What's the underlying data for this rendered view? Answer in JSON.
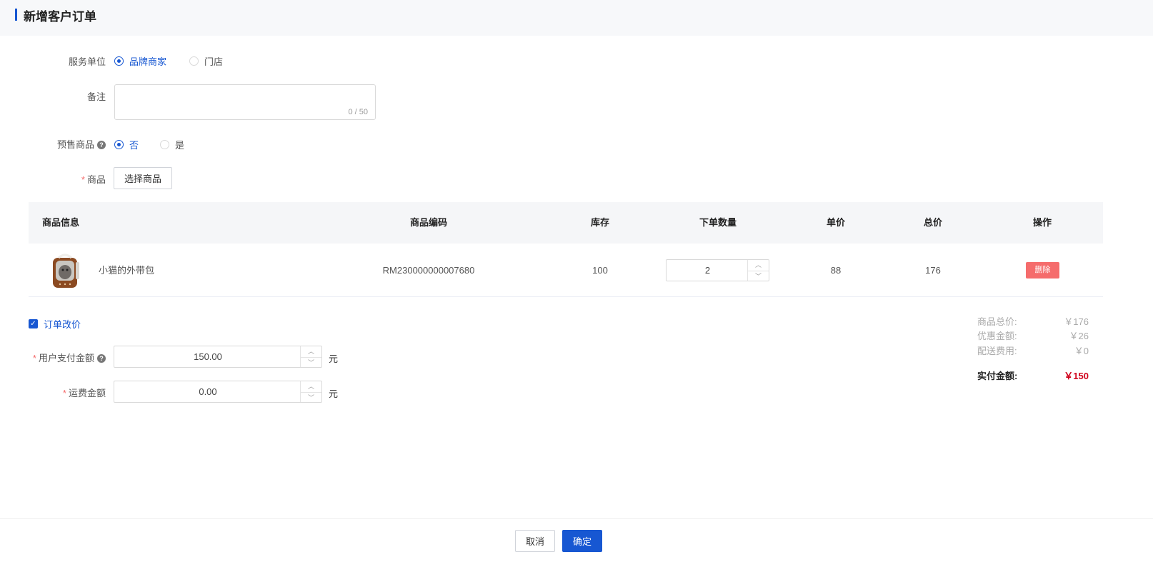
{
  "header": {
    "title": "新增客户订单"
  },
  "form": {
    "service_unit": {
      "label": "服务单位",
      "options": [
        "品牌商家",
        "门店"
      ],
      "selected": "品牌商家"
    },
    "remark": {
      "label": "备注",
      "value": "",
      "counter": "0 / 50"
    },
    "presale": {
      "label": "预售商品",
      "help": "?",
      "options": [
        "否",
        "是"
      ],
      "selected": "否"
    },
    "goods": {
      "required": "*",
      "label": "商品",
      "select_button": "选择商品"
    }
  },
  "table": {
    "columns": [
      "商品信息",
      "商品编码",
      "库存",
      "下单数量",
      "单价",
      "总价",
      "操作"
    ],
    "rows": [
      {
        "name": "小猫的外带包",
        "code": "RM230000000007680",
        "stock": "100",
        "quantity": "2",
        "unit_price": "88",
        "total": "176",
        "action": "删除"
      }
    ]
  },
  "price_change": {
    "checkbox_label": "订单改价",
    "checked": true,
    "user_payment": {
      "required": "*",
      "label": "用户支付金额",
      "help": "?",
      "value": "150.00",
      "unit": "元"
    },
    "freight": {
      "required": "*",
      "label": "运费金额",
      "value": "0.00",
      "unit": "元"
    }
  },
  "summary": {
    "goods_total": {
      "label": "商品总价:",
      "value": "￥176"
    },
    "discount": {
      "label": "优惠金额:",
      "value": "￥26"
    },
    "delivery": {
      "label": "配送费用:",
      "value": "￥0"
    },
    "paid": {
      "label": "实付金额:",
      "value": "￥150"
    }
  },
  "footer": {
    "cancel": "取消",
    "confirm": "确定"
  },
  "colors": {
    "primary": "#1757d2",
    "danger": "#f56c6c",
    "paid_amount": "#d0021b"
  }
}
